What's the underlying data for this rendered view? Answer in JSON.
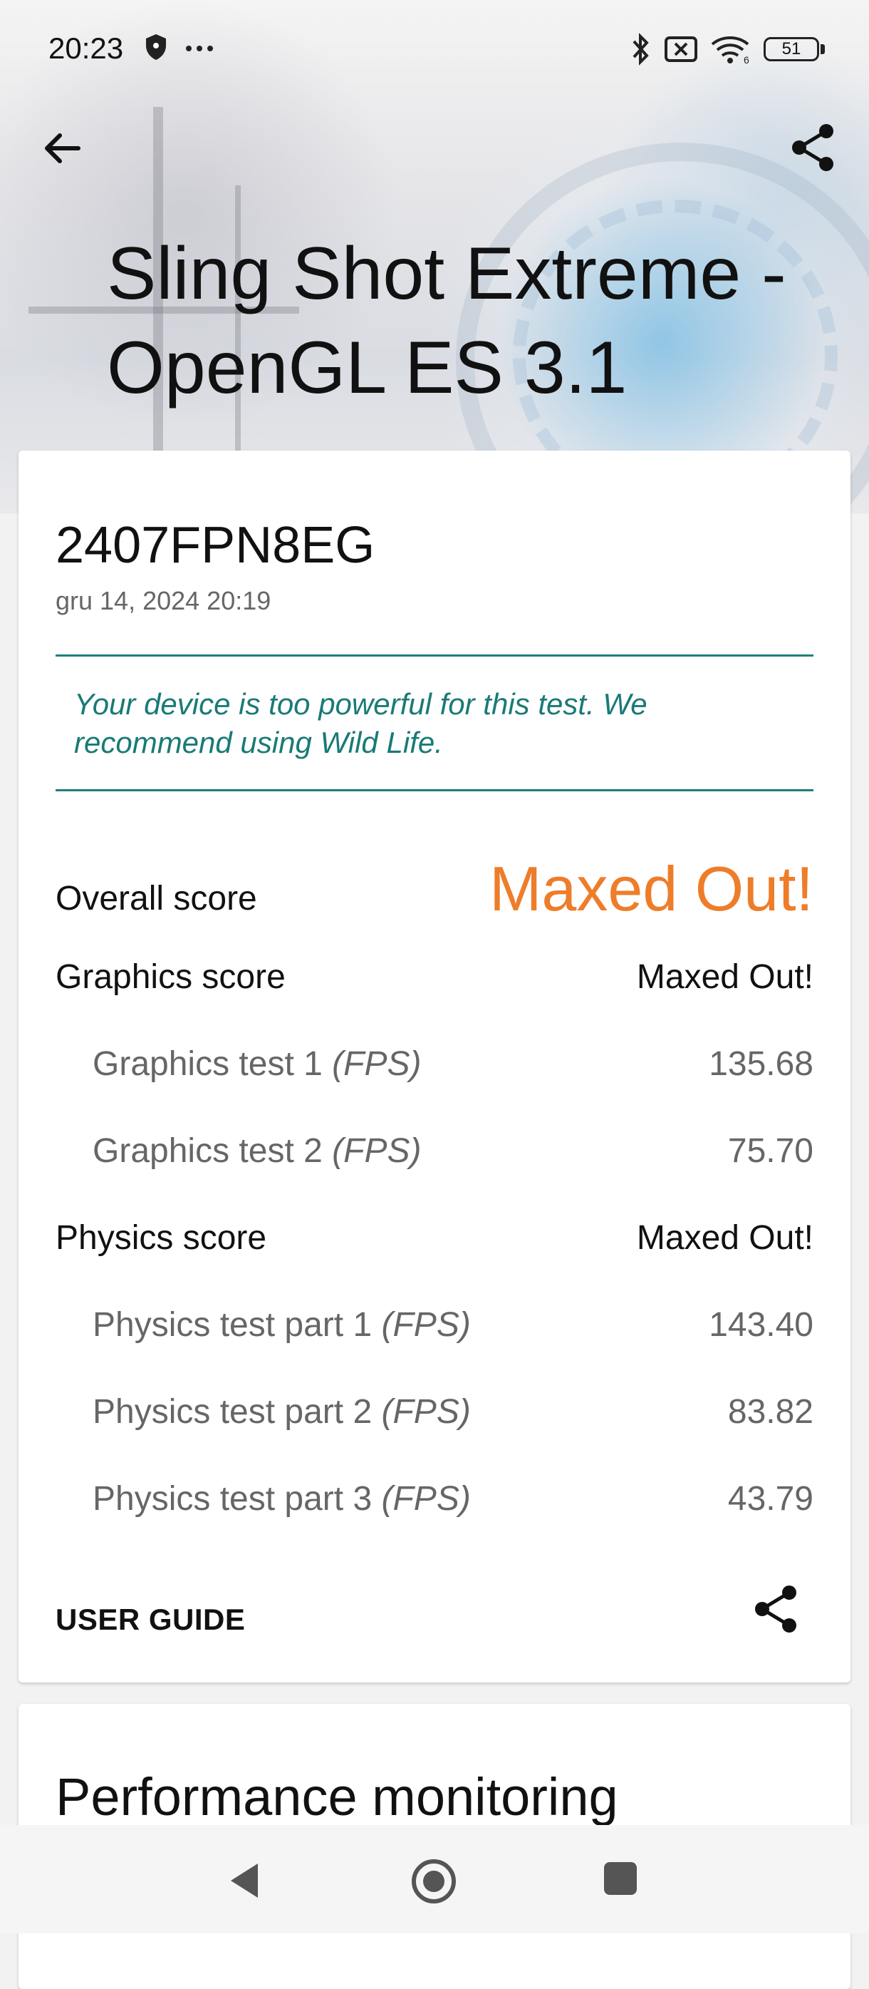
{
  "status_bar": {
    "time": "20:23",
    "battery": "51",
    "icons": [
      "shield-icon",
      "more-dots-icon",
      "bluetooth-icon",
      "no-sim-icon",
      "wifi-icon",
      "battery-icon"
    ]
  },
  "header": {
    "title": "Sling Shot Extreme - OpenGL ES 3.1",
    "back_icon": "arrow-back-icon",
    "share_icon": "share-icon"
  },
  "result": {
    "device": "2407FPN8EG",
    "date": "gru 14, 2024 20:19",
    "warning": "Your device is too powerful for this test. We recommend using Wild Life.",
    "overall": {
      "label": "Overall score",
      "value": "Maxed Out!"
    },
    "graphics": {
      "label": "Graphics score",
      "value": "Maxed Out!"
    },
    "graphics_tests": [
      {
        "label": "Graphics test 1 ",
        "unit": "(FPS)",
        "value": "135.68"
      },
      {
        "label": "Graphics test 2 ",
        "unit": "(FPS)",
        "value": "75.70"
      }
    ],
    "physics": {
      "label": "Physics score",
      "value": "Maxed Out!"
    },
    "physics_tests": [
      {
        "label": "Physics test part 1 ",
        "unit": "(FPS)",
        "value": "143.40"
      },
      {
        "label": "Physics test part 2 ",
        "unit": "(FPS)",
        "value": "83.82"
      },
      {
        "label": "Physics test part 3 ",
        "unit": "(FPS)",
        "value": "43.79"
      }
    ],
    "user_guide": "USER GUIDE"
  },
  "performance": {
    "title": "Performance monitoring"
  },
  "colors": {
    "accent": "#ee7d2a",
    "teal": "#1e7f7a"
  }
}
